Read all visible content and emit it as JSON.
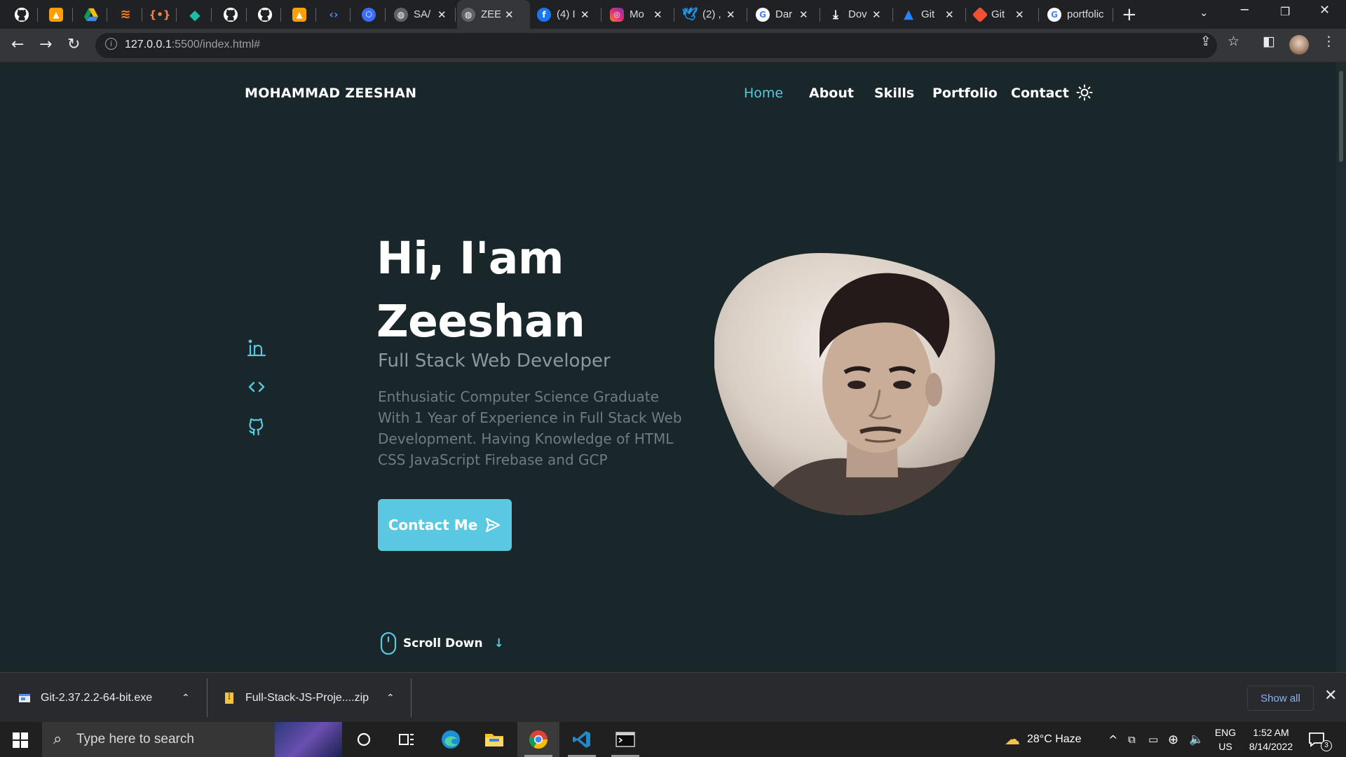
{
  "browser": {
    "tabs": [
      {
        "title": "",
        "icon": "github-icon"
      },
      {
        "title": "",
        "icon": "firebase-icon"
      },
      {
        "title": "",
        "icon": "google-drive-icon"
      },
      {
        "title": "",
        "icon": "stackoverflow-icon"
      },
      {
        "title": "",
        "icon": "code-brackets-icon"
      },
      {
        "title": "",
        "icon": "diamond-icon"
      },
      {
        "title": "",
        "icon": "github-icon"
      },
      {
        "title": "",
        "icon": "github-icon"
      },
      {
        "title": "",
        "icon": "firebase-icon"
      },
      {
        "title": "",
        "icon": "code-icon"
      },
      {
        "title": "",
        "icon": "hexagon-icon"
      },
      {
        "title": "SA/",
        "icon": "globe-icon"
      },
      {
        "title": "ZEE",
        "icon": "globe-icon",
        "active": true
      },
      {
        "title": "(4) I",
        "icon": "facebook-icon"
      },
      {
        "title": "Mo",
        "icon": "instagram-icon"
      },
      {
        "title": "(2) ,",
        "icon": "twitter-icon"
      },
      {
        "title": "Dar",
        "icon": "google-icon"
      },
      {
        "title": "Dov",
        "icon": "download-icon"
      },
      {
        "title": "Git",
        "icon": "atlassian-icon"
      },
      {
        "title": "Git",
        "icon": "git-icon"
      },
      {
        "title": "portfolic",
        "icon": "google-icon"
      }
    ],
    "url_host": "127.0.0.1",
    "url_rest": ":5500/index.html#"
  },
  "site": {
    "brand": "MOHAMMAD ZEESHAN",
    "nav": [
      "Home",
      "About",
      "Skills",
      "Portfolio",
      "Contact"
    ],
    "active_nav": "Home",
    "hero": {
      "title_line1": "Hi, I'am",
      "title_line2": "Zeeshan",
      "subtitle": "Full Stack Web Developer",
      "description": "Enthusiatic Computer Science Graduate With 1 Year of Experience in Full Stack Web Development. Having Knowledge of HTML CSS JavaScript Firebase and GCP",
      "cta": "Contact Me",
      "scroll": "Scroll Down"
    },
    "socials": [
      "linkedin-icon",
      "code-icon",
      "github-icon"
    ],
    "accent": "#5ac8e0",
    "background": "#19262a"
  },
  "downloads": {
    "items": [
      "Git-2.37.2.2-64-bit.exe",
      "Full-Stack-JS-Proje....zip"
    ],
    "show_all": "Show all"
  },
  "taskbar": {
    "search_placeholder": "Type here to search",
    "weather": "28°C  Haze",
    "lang_top": "ENG",
    "lang_bottom": "US",
    "time": "1:52 AM",
    "date": "8/14/2022",
    "notifications": "3"
  }
}
